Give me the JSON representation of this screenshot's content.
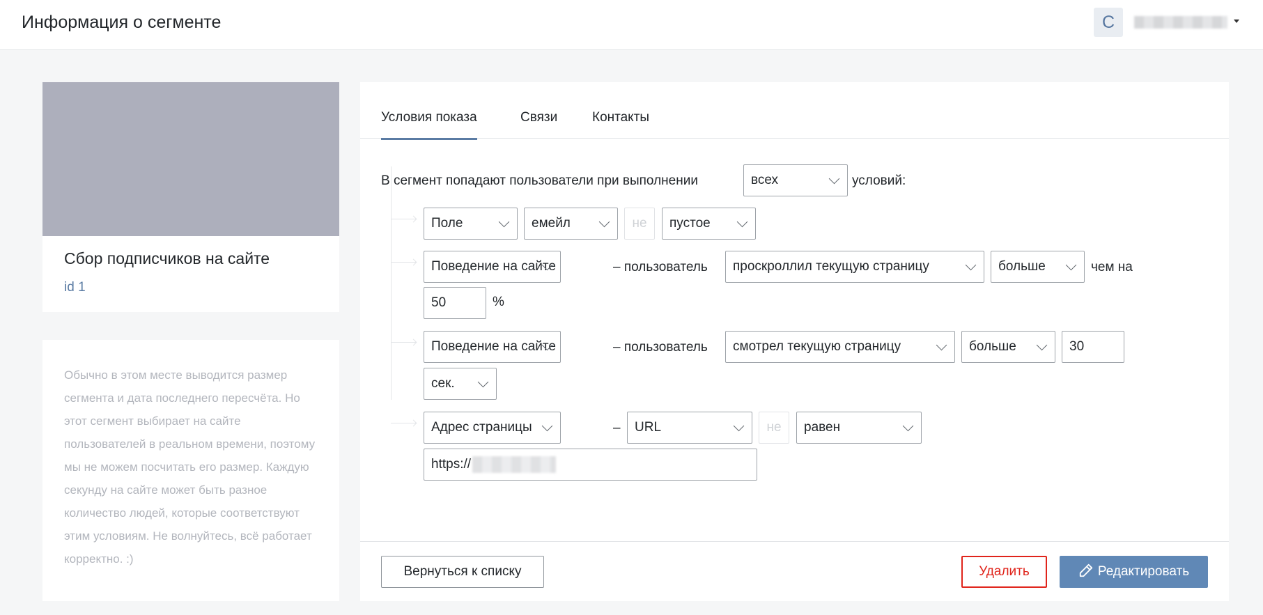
{
  "header": {
    "title": "Информация о сегменте",
    "avatar_letter": "С"
  },
  "segment": {
    "name": "Сбор подписчиков на сайте",
    "id_label": "id 1"
  },
  "info": {
    "text": "Обычно в этом месте выводится размер сегмента и дата последнего пересчёта. Но этот сегмент выбирает на сайте пользователей в реальном времени, поэтому мы не можем посчитать его размер. Каждую секунду на сайте может быть разное количество людей, которые соответствуют этим условиям. Не волнуйтесь, всё работает корректно. :)"
  },
  "tabs": [
    "Условия показа",
    "Связи",
    "Контакты"
  ],
  "conditions": {
    "intro_prefix": "В сегмент попадают пользователи при выполнении",
    "match_select": "всех",
    "intro_suffix": "условий:",
    "row1": {
      "type": "Поле",
      "field": "емейл",
      "not": "не",
      "op": "пустое"
    },
    "row2": {
      "type": "Поведение на сайте",
      "dash_user": "– пользователь",
      "action": "проскроллил текущую страницу",
      "cmp": "больше",
      "than": "чем на",
      "value": "50",
      "unit": "%"
    },
    "row3": {
      "type": "Поведение на сайте",
      "dash_user": "– пользователь",
      "action": "смотрел текущую страницу",
      "cmp": "больше",
      "value": "30",
      "unit": "сек."
    },
    "row4": {
      "type": "Адрес страницы",
      "dash": "–",
      "part": "URL",
      "not": "не",
      "op": "равен",
      "value": "https://"
    }
  },
  "footer": {
    "back": "Вернуться к списку",
    "delete": "Удалить",
    "edit": "Редактировать"
  },
  "colors": {
    "accent": "#5a7ba3",
    "edit_button": "#6088b6",
    "delete": "#e0241b"
  }
}
